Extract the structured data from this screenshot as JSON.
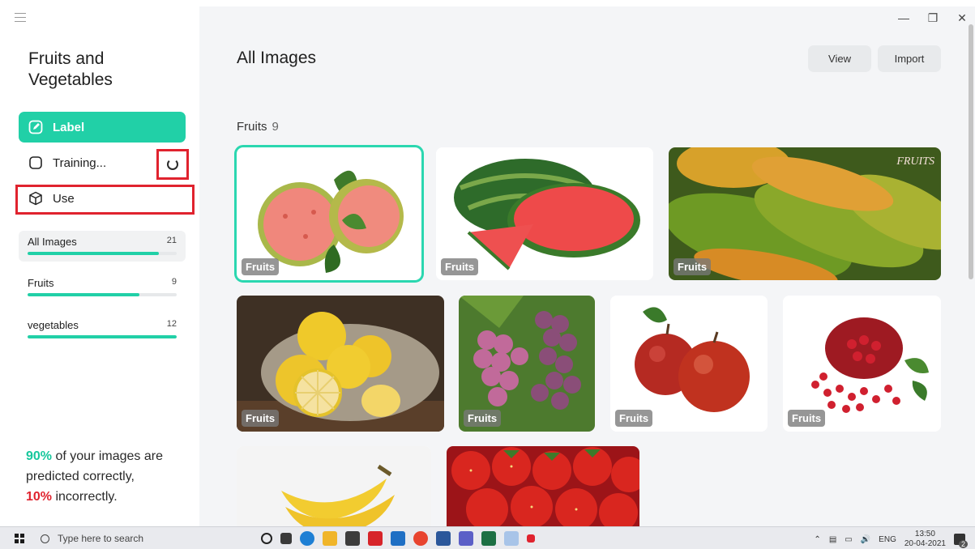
{
  "sidebar": {
    "project_title": "Fruits and Vegetables",
    "nav": {
      "label": "Label",
      "training": "Training...",
      "use": "Use"
    },
    "categories": [
      {
        "name": "All Images",
        "count": "21",
        "progress": 0.88
      },
      {
        "name": "Fruits",
        "count": "9",
        "progress": 0.75
      },
      {
        "name": "vegetables",
        "count": "12",
        "progress": 1.0
      }
    ],
    "stats": {
      "correct_pct": "90%",
      "correct_text": " of your images are predicted correctly,",
      "incorrect_pct": "10%",
      "incorrect_text": " incorrectly."
    }
  },
  "main": {
    "title": "All Images",
    "buttons": {
      "view": "View",
      "import": "Import"
    },
    "section": {
      "name": "Fruits",
      "count": "9"
    },
    "tiles": [
      {
        "tag": "Fruits",
        "subject": "guava"
      },
      {
        "tag": "Fruits",
        "subject": "watermelon"
      },
      {
        "tag": "Fruits",
        "subject": "papaya",
        "stamp": "FRUITS"
      },
      {
        "tag": "Fruits",
        "subject": "lemons"
      },
      {
        "tag": "Fruits",
        "subject": "grapes"
      },
      {
        "tag": "Fruits",
        "subject": "apples"
      },
      {
        "tag": "Fruits",
        "subject": "pomegranate"
      },
      {
        "subject": "bananas"
      },
      {
        "subject": "strawberries"
      }
    ]
  },
  "taskbar": {
    "search_placeholder": "Type here to search",
    "language": "ENG",
    "time": "13:50",
    "date": "20-04-2021",
    "notifications": "2"
  },
  "colors": {
    "accent": "#21d0a7",
    "highlight": "#e0232e"
  }
}
